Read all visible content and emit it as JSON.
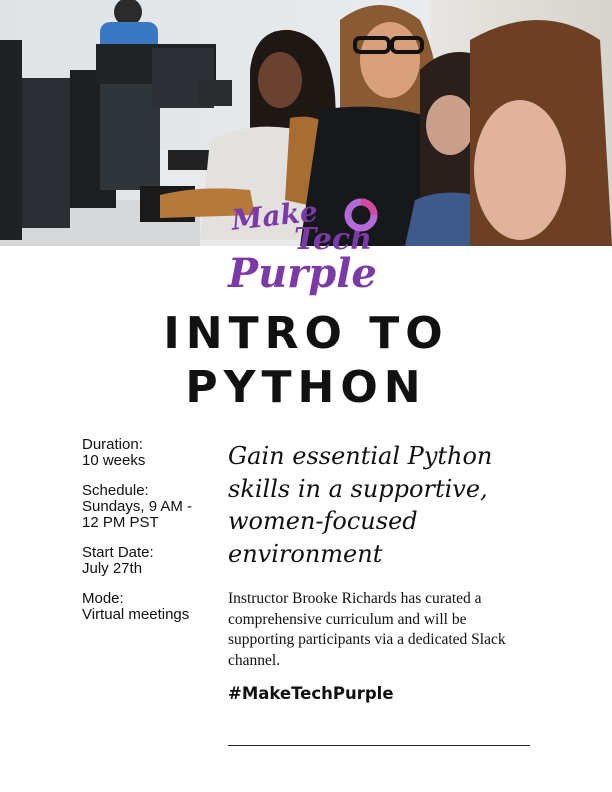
{
  "hero": {
    "description_icon": "classroom-photo"
  },
  "logo": {
    "line1": "Make",
    "line2": "Tech",
    "line3": "Purple",
    "color": "#7b3aa8",
    "ring_color": "#d14aa0"
  },
  "title": {
    "line1": "INTRO TO",
    "line2": "PYTHON"
  },
  "details": [
    {
      "label": "Duration:",
      "value": "10 weeks"
    },
    {
      "label": "Schedule:",
      "value": "Sundays, 9 AM - 12 PM PST"
    },
    {
      "label": "Start Date:",
      "value": "July 27th"
    },
    {
      "label": "Mode:",
      "value": "Virtual meetings"
    }
  ],
  "tagline": "Gain essential Python skills in a supportive, women-focused environment",
  "description": "Instructor Brooke Richards has curated a comprehensive curriculum and will be supporting participants via a dedicated Slack channel.",
  "hashtag": "#MakeTechPurple"
}
